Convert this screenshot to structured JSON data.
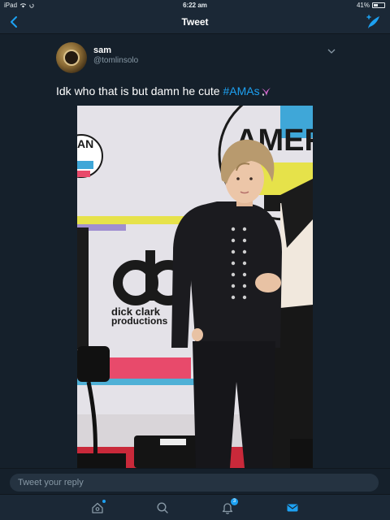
{
  "status_bar": {
    "device": "iPad",
    "time": "6:22 am",
    "battery": "41%",
    "battery_level": 0.41
  },
  "nav": {
    "title": "Tweet",
    "back_icon": "chevron-left-icon",
    "compose_icon": "compose-tweet-icon"
  },
  "tweet": {
    "user": {
      "name": "sam",
      "handle": "@tomlinsolo"
    },
    "text": "Idk who that is but damn he cute ",
    "hashtag": "#AMAs",
    "media_alt": "Person in black suit at AMAs red carpet backdrop",
    "backdrop_text": {
      "line1": "dick clark",
      "line2": "productions",
      "top": "AMER",
      "left_badge": "AN"
    }
  },
  "reply": {
    "placeholder": "Tweet your reply"
  },
  "tabs": {
    "home": "home-icon",
    "search": "search-icon",
    "notifications": "bell-icon",
    "notifications_count": "3",
    "messages": "mail-icon"
  },
  "colors": {
    "accent": "#1da1f2",
    "background": "#15202b",
    "bar": "#1b2836",
    "muted": "#8899a6"
  }
}
